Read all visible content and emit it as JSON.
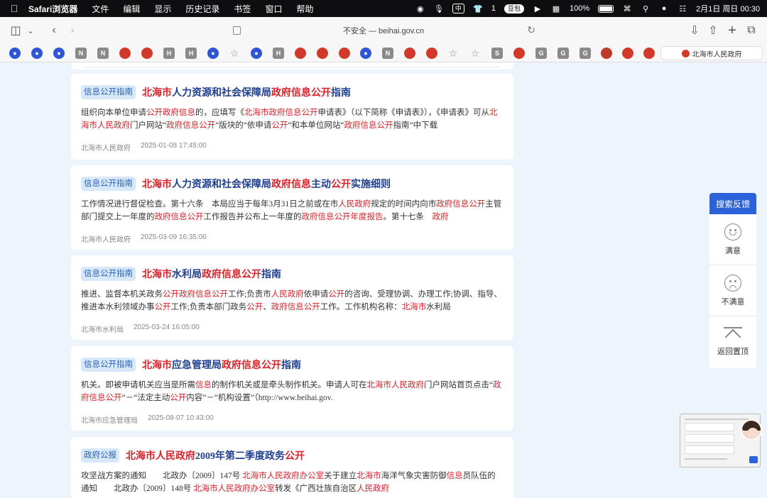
{
  "menubar": {
    "app": "Safari浏览器",
    "items": [
      "文件",
      "编辑",
      "显示",
      "历史记录",
      "书签",
      "窗口",
      "帮助"
    ],
    "status": {
      "badge1": "中",
      "badge2": "1",
      "pill": "豆包",
      "battery": "100%",
      "datetime": "2月1日 周日  00:30"
    }
  },
  "toolbar": {
    "address": "不安全 — beihai.gov.cn"
  },
  "favorites": {
    "icons": [
      "paw",
      "paw",
      "paw",
      "N",
      "N",
      "emblem",
      "emblem",
      "H",
      "H",
      "paw",
      "star",
      "paw",
      "H",
      "emblem",
      "emblem",
      "emblem",
      "paw",
      "N",
      "emblem",
      "emblem",
      "star",
      "star",
      "S",
      "emblem",
      "G",
      "G",
      "G",
      "red",
      "emblem",
      "emblem"
    ],
    "active_tab": "北海市人民政府"
  },
  "results": [
    {
      "badge": "信息公开指南",
      "title": [
        {
          "t": "北海市",
          "hl": true
        },
        {
          "t": "人力资源和社会保障局",
          "hl": false
        },
        {
          "t": "政府信息公开",
          "hl": true
        },
        {
          "t": "指南",
          "hl": false
        }
      ],
      "snippet": [
        {
          "t": "组织向本单位申请",
          "hl": false
        },
        {
          "t": "公开政府信息",
          "hl": true
        },
        {
          "t": "的，应填写《",
          "hl": false
        },
        {
          "t": "北海市政府信息公开",
          "hl": true
        },
        {
          "t": "申请表》（以下简称《申请表》），《申请表》可从",
          "hl": false
        },
        {
          "t": "北海市人民政府",
          "hl": true
        },
        {
          "t": "门户网站“",
          "hl": false
        },
        {
          "t": "政府信息公开",
          "hl": true
        },
        {
          "t": "”版块的“依申请",
          "hl": false
        },
        {
          "t": "公开",
          "hl": true
        },
        {
          "t": "”和本单位网站“",
          "hl": false
        },
        {
          "t": "政府信息公开",
          "hl": true
        },
        {
          "t": "指南”中下载",
          "hl": false
        }
      ],
      "source": "北海市人民政府",
      "date": "2025-01-08 17:45:00"
    },
    {
      "badge": "信息公开指南",
      "title": [
        {
          "t": "北海市",
          "hl": true
        },
        {
          "t": "人力资源和社会保障局",
          "hl": false
        },
        {
          "t": "政府信息",
          "hl": true
        },
        {
          "t": "主动",
          "hl": false
        },
        {
          "t": "公开",
          "hl": true
        },
        {
          "t": "实施细则",
          "hl": false
        }
      ],
      "snippet": [
        {
          "t": "工作情况进行督促检查。第十六条　本局应当于每年3月31日之前或在市",
          "hl": false
        },
        {
          "t": "人民政府",
          "hl": true
        },
        {
          "t": "规定的时间内向市",
          "hl": false
        },
        {
          "t": "政府信息公开",
          "hl": true
        },
        {
          "t": "主管部门提交上一年度的",
          "hl": false
        },
        {
          "t": "政府信息公开",
          "hl": true
        },
        {
          "t": "工作报告并公布上一年度的",
          "hl": false
        },
        {
          "t": "政府信息公开年度报告",
          "hl": true
        },
        {
          "t": "。第十七条　",
          "hl": false
        },
        {
          "t": "政府",
          "hl": true
        }
      ],
      "source": "北海市人民政府",
      "date": "2025-03-09 16:35:00"
    },
    {
      "badge": "信息公开指南",
      "title": [
        {
          "t": "北海市",
          "hl": true
        },
        {
          "t": "水利局",
          "hl": false
        },
        {
          "t": "政府信息公开",
          "hl": true
        },
        {
          "t": "指南",
          "hl": false
        }
      ],
      "snippet": [
        {
          "t": "推进、监督本机关政务",
          "hl": false
        },
        {
          "t": "公开政府信息公开",
          "hl": true
        },
        {
          "t": "工作;负责市",
          "hl": false
        },
        {
          "t": "人民政府",
          "hl": true
        },
        {
          "t": "依申请",
          "hl": false
        },
        {
          "t": "公开",
          "hl": true
        },
        {
          "t": "的咨询、受理协调、办理工作;协调、指导、推进本水利领域办事",
          "hl": false
        },
        {
          "t": "公开",
          "hl": true
        },
        {
          "t": "工作;负责本部门政务",
          "hl": false
        },
        {
          "t": "公开",
          "hl": true
        },
        {
          "t": "、",
          "hl": false
        },
        {
          "t": "政府信息公开",
          "hl": true
        },
        {
          "t": "工作。工作机构名称：",
          "hl": false
        },
        {
          "t": "北海市",
          "hl": true
        },
        {
          "t": "水利局",
          "hl": false
        }
      ],
      "source": "北海市水利局",
      "date": "2025-03-24 16:05:00"
    },
    {
      "badge": "信息公开指南",
      "title": [
        {
          "t": "北海市",
          "hl": true
        },
        {
          "t": "应急管理局",
          "hl": false
        },
        {
          "t": "政府信息公开",
          "hl": true
        },
        {
          "t": "指南",
          "hl": false
        }
      ],
      "snippet": [
        {
          "t": "机关。即被申请机关应当是所需",
          "hl": false
        },
        {
          "t": "信息",
          "hl": true
        },
        {
          "t": "的制作机关或是牵头制作机关。申请人可在",
          "hl": false
        },
        {
          "t": "北海市人民政府",
          "hl": true
        },
        {
          "t": "门户网站首页点击“",
          "hl": false
        },
        {
          "t": "政府信息公开",
          "hl": true
        },
        {
          "t": "”－“法定主动",
          "hl": false
        },
        {
          "t": "公开",
          "hl": true
        },
        {
          "t": "内容”－“机构设置”（http://www.beihai.gov.",
          "hl": false
        }
      ],
      "source": "北海市应急管理局",
      "date": "2025-08-07 10:43:00"
    },
    {
      "badge": "政府公报",
      "title": [
        {
          "t": "北海市人民政府",
          "hl": true
        },
        {
          "t": "2009年第二季度政务",
          "hl": false
        },
        {
          "t": "公开",
          "hl": true
        }
      ],
      "snippet": [
        {
          "t": "攻坚战方案的通知　　北政办〔2009〕147号 ",
          "hl": false
        },
        {
          "t": "北海市人民政府办公室",
          "hl": true
        },
        {
          "t": "关于建立",
          "hl": false
        },
        {
          "t": "北海市",
          "hl": true
        },
        {
          "t": "海洋气象灾害防御",
          "hl": false
        },
        {
          "t": "信息",
          "hl": true
        },
        {
          "t": "员队伍的通知　　北政办〔2009〕148号 ",
          "hl": false
        },
        {
          "t": "北海市人民政府办公室",
          "hl": true
        },
        {
          "t": "转发《广西壮族自治区",
          "hl": false
        },
        {
          "t": "人民政府",
          "hl": true
        }
      ],
      "source": "",
      "date": ""
    }
  ],
  "feedback": {
    "header": "搜索反馈",
    "satisfied": "满意",
    "unsatisfied": "不满意",
    "back_to_top": "返回置顶"
  }
}
